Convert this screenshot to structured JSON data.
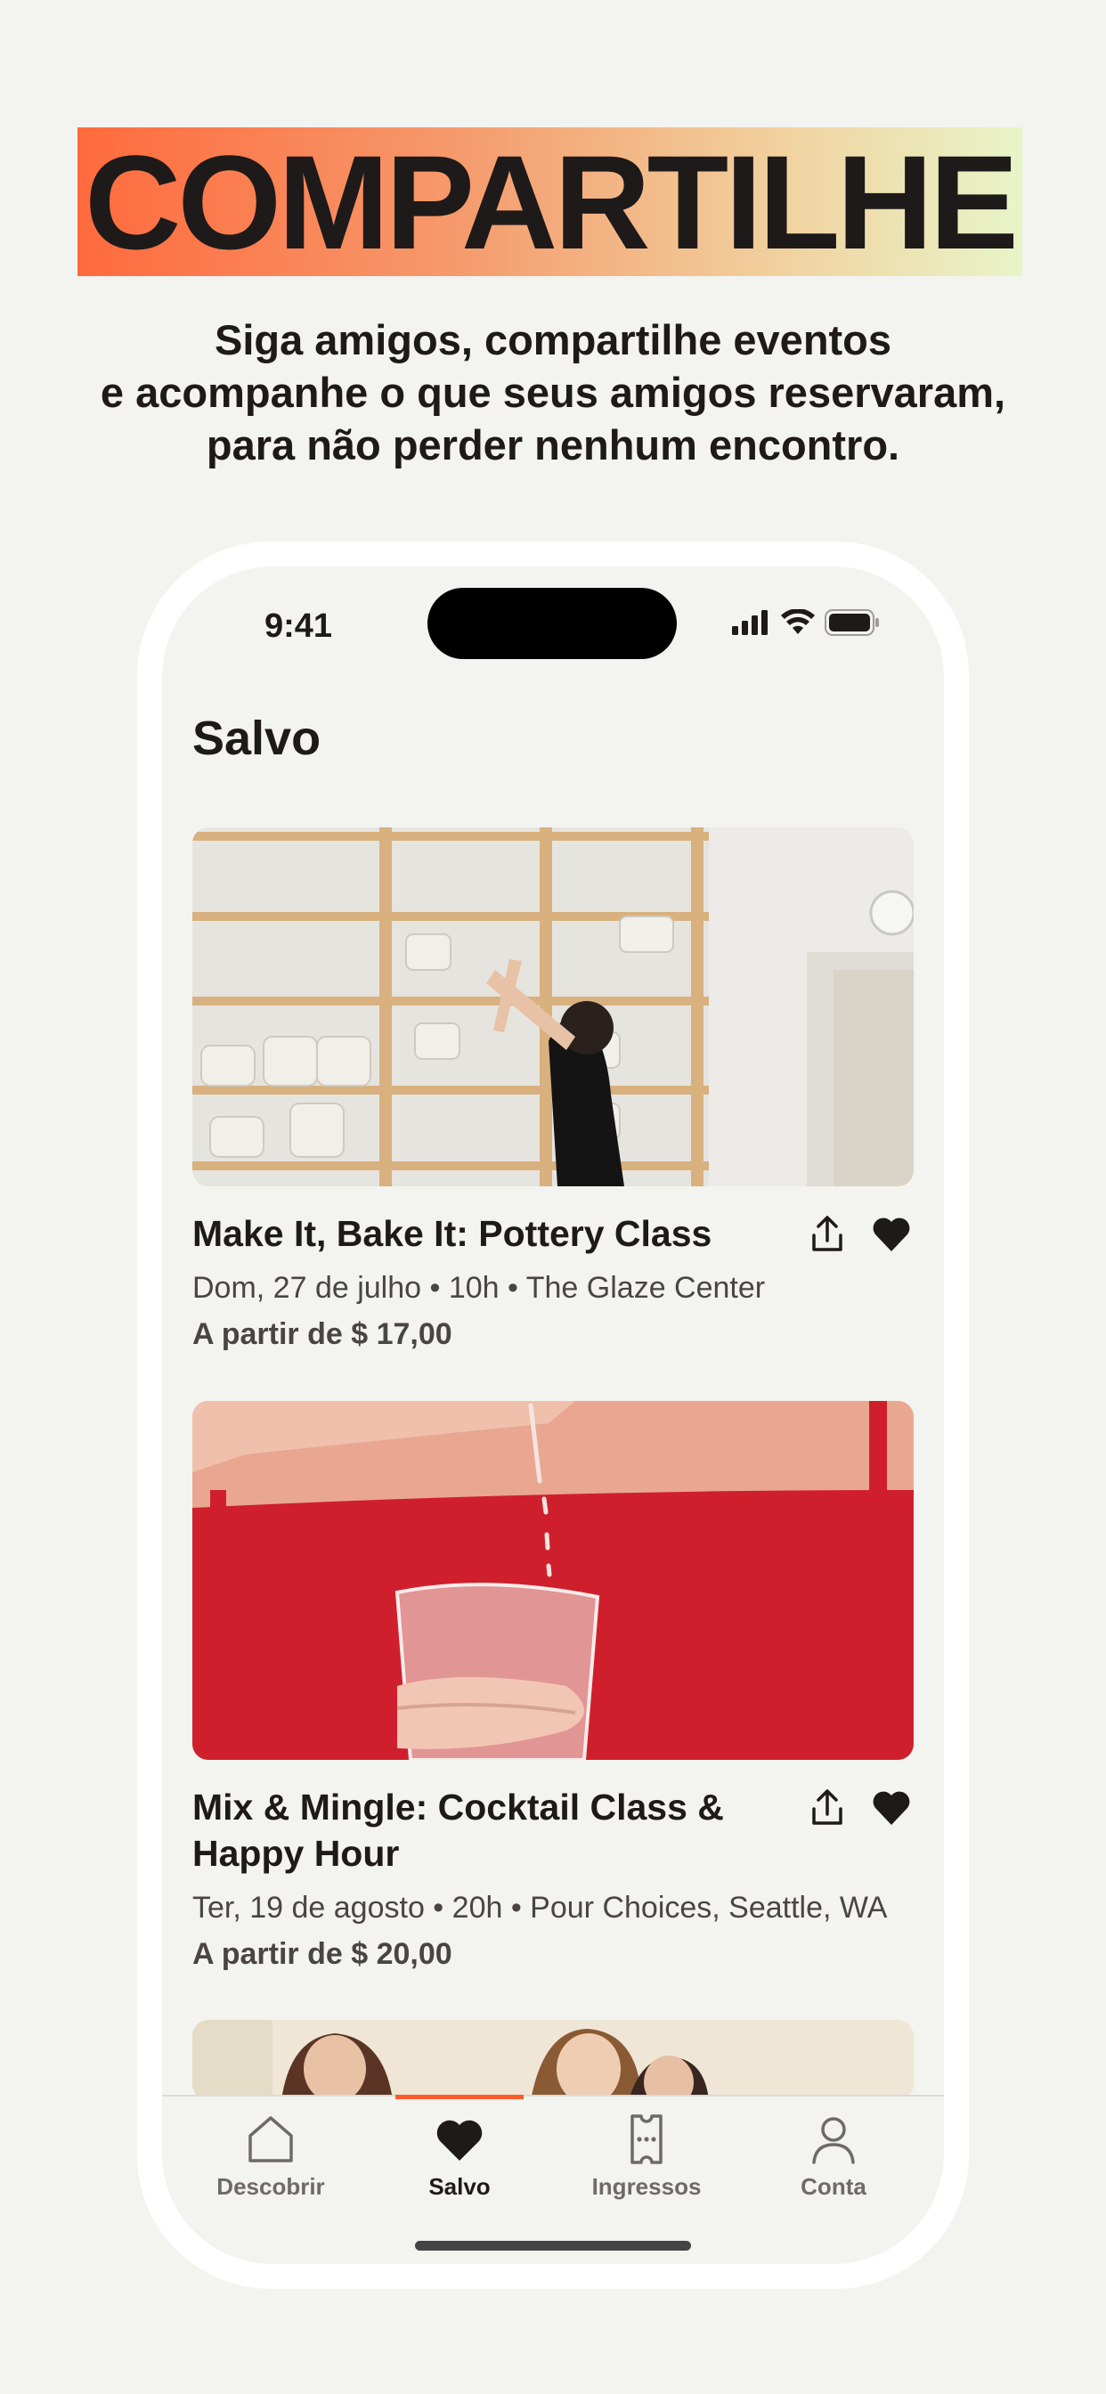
{
  "headline": "COMPARTILHE",
  "subtitle": {
    "line1": "Siga amigos, compartilhe eventos",
    "line2": "e acompanhe o que seus amigos reservaram,",
    "line3": "para não perder nenhum encontro."
  },
  "status_bar": {
    "time": "9:41"
  },
  "screen": {
    "title": "Salvo"
  },
  "events": [
    {
      "title": "Make It, Bake It: Pottery Class",
      "meta": "Dom, 27 de julho • 10h • The Glaze Center",
      "price": "A partir de $ 17,00"
    },
    {
      "title": "Mix & Mingle: Cocktail Class & Happy Hour",
      "meta": "Ter, 19 de agosto • 20h • Pour Choices, Seattle, WA",
      "price": "A partir de $ 20,00"
    }
  ],
  "tabs": [
    {
      "label": "Descobrir",
      "icon": "home-icon"
    },
    {
      "label": "Salvo",
      "icon": "heart-icon",
      "active": true
    },
    {
      "label": "Ingressos",
      "icon": "ticket-icon"
    },
    {
      "label": "Conta",
      "icon": "user-icon"
    }
  ],
  "colors": {
    "accent": "#ff5a2c",
    "background": "#f3f3ef",
    "text": "#1e1a1a"
  }
}
